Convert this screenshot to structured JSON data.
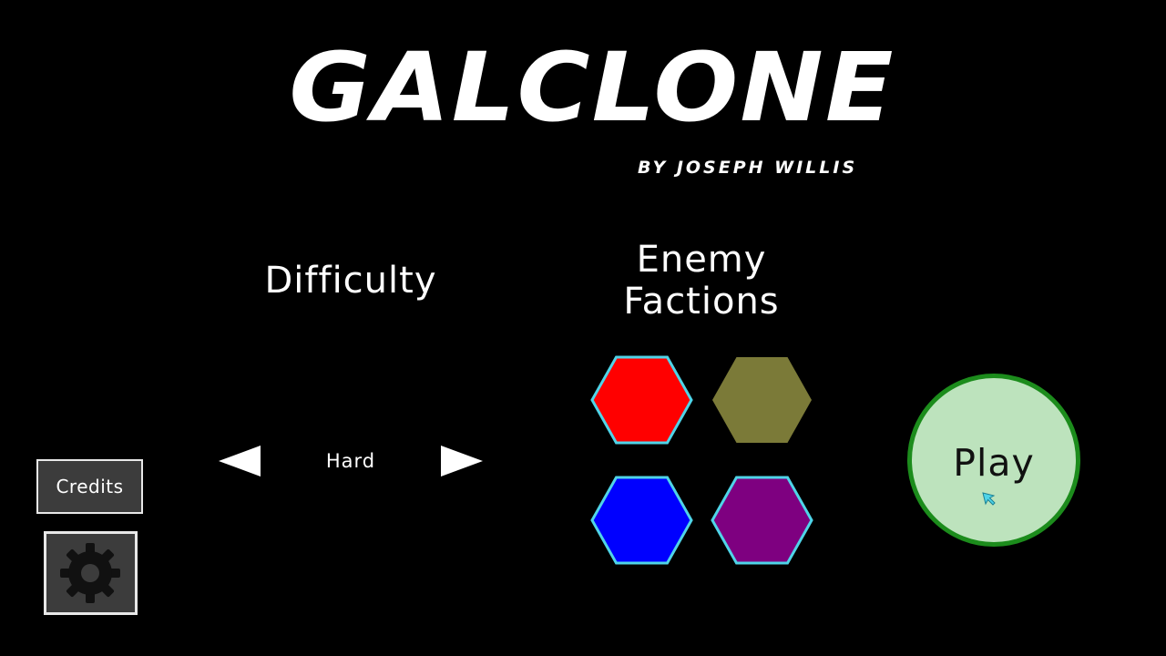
{
  "title": {
    "name": "GALCLONE",
    "author": "BY JOSEPH WILLIS"
  },
  "difficulty": {
    "heading": "Difficulty",
    "value": "Hard"
  },
  "factions": {
    "heading_line1": "Enemy",
    "heading_line2": "Factions",
    "hexes": [
      {
        "color": "#ff0000",
        "selected": true
      },
      {
        "color": "#7b7a38",
        "selected": false
      },
      {
        "color": "#0000ff",
        "selected": true
      },
      {
        "color": "#7e0080",
        "selected": true
      }
    ],
    "selected_outline_color": "#4fd4e8"
  },
  "play": {
    "label": "Play",
    "fill_color": "#bde3bd",
    "ring_color": "#1c8c1c"
  },
  "menu": {
    "credits_label": "Credits",
    "settings_icon": "gear-icon"
  },
  "cursor": {
    "icon": "cursor-arrow-icon",
    "color": "#4fd4e8"
  }
}
